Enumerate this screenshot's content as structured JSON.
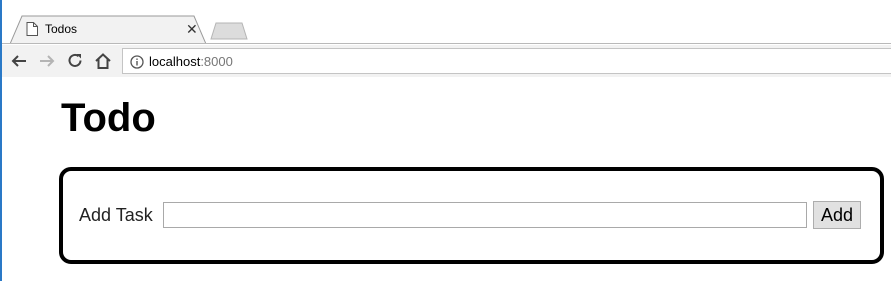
{
  "browser": {
    "tab": {
      "title": "Todos",
      "icon": "document-icon",
      "close_icon": "close-icon",
      "close_label": "✕"
    },
    "toolbar": {
      "back_icon": "back-arrow-icon",
      "forward_icon": "forward-arrow-icon",
      "reload_icon": "reload-icon",
      "home_icon": "home-icon",
      "info_icon": "info-icon",
      "url_host": "localhost",
      "url_port": ":8000"
    }
  },
  "page": {
    "title": "Todo",
    "form": {
      "label": "Add Task",
      "input_value": "",
      "button_label": "Add"
    }
  },
  "colors": {
    "accent_edge": "#2a79c7",
    "toolbar_bg": "#f2f2f2",
    "box_border": "#000000",
    "button_bg": "#e1e1e1"
  }
}
